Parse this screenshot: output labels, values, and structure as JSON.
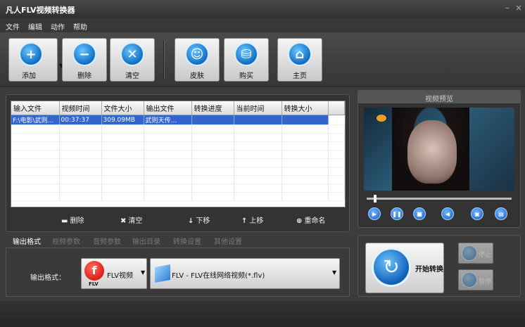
{
  "app": {
    "title": "凡人FLV视频转换器"
  },
  "window_controls": [
    "–",
    "×"
  ],
  "menu": [
    "文件",
    "编辑",
    "动作",
    "帮助"
  ],
  "toolbar": {
    "buttons": [
      {
        "label": "添加",
        "icon": "plus-icon"
      },
      {
        "label": "删除",
        "icon": "minus-icon"
      },
      {
        "label": "清空",
        "icon": "x-icon"
      },
      {
        "label": "皮肤",
        "icon": "smiley-icon"
      },
      {
        "label": "购买",
        "icon": "cart-icon"
      },
      {
        "label": "主页",
        "icon": "home-icon"
      }
    ]
  },
  "file_list": {
    "columns": [
      "输入文件",
      "视频时间",
      "文件大小",
      "输出文件",
      "转换进度",
      "当前时间",
      "转换大小"
    ],
    "rows": [
      [
        "F:\\电影\\武则...",
        "00:37:37",
        "309.09MB",
        "武则天传...",
        "",
        "",
        ""
      ]
    ]
  },
  "list_actions": [
    {
      "glyph": "▬",
      "label": "删除"
    },
    {
      "glyph": "✖",
      "label": "清空"
    },
    {
      "glyph": "↓",
      "label": "下移"
    },
    {
      "glyph": "↑",
      "label": "上移"
    },
    {
      "glyph": "⊕",
      "label": "重命名"
    }
  ],
  "preview": {
    "title": "视频预览",
    "controls": [
      "play-icon",
      "pause-icon",
      "stop-icon",
      "volume-icon",
      "snapshot-icon",
      "folder-icon"
    ]
  },
  "settings_tabs": [
    "输出格式",
    "视频参数",
    "音频参数",
    "输出目录",
    "转换设置",
    "其他设置"
  ],
  "output_format": {
    "label": "输出格式：",
    "format": "FLV视频",
    "format_sub": "FLV",
    "preset": "FLV - FLV在线网络视频(*.flv)"
  },
  "convert": {
    "start_label": "开始转换",
    "stop_label": "停止",
    "pause_label": "暂停"
  },
  "colors": {
    "selection": "#3366cc",
    "accent_blue": "#1b5fc4",
    "flv_red": "#cc0000"
  }
}
